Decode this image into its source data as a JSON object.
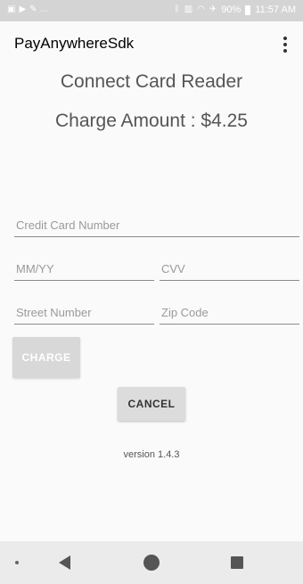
{
  "status_bar": {
    "battery": "90%",
    "time": "11:57 AM",
    "ellipsis": "..."
  },
  "app_bar": {
    "title": "PayAnywhereSdk"
  },
  "headings": {
    "connect": "Connect Card Reader",
    "charge": "Charge Amount : $4.25"
  },
  "form": {
    "card_number": {
      "value": "",
      "placeholder": "Credit Card Number"
    },
    "expiry": {
      "value": "",
      "placeholder": "MM/YY"
    },
    "cvv": {
      "value": "",
      "placeholder": "CVV"
    },
    "street": {
      "value": "",
      "placeholder": "Street Number"
    },
    "zip": {
      "value": "",
      "placeholder": "Zip Code"
    }
  },
  "buttons": {
    "charge": "CHARGE",
    "cancel": "CANCEL"
  },
  "footer": {
    "version": "version 1.4.3"
  },
  "colors": {
    "background": "#fafafa",
    "status_bar": "#d4d4d4",
    "nav_bar": "#ebebeb",
    "disabled_button": "#d8d8d8"
  }
}
